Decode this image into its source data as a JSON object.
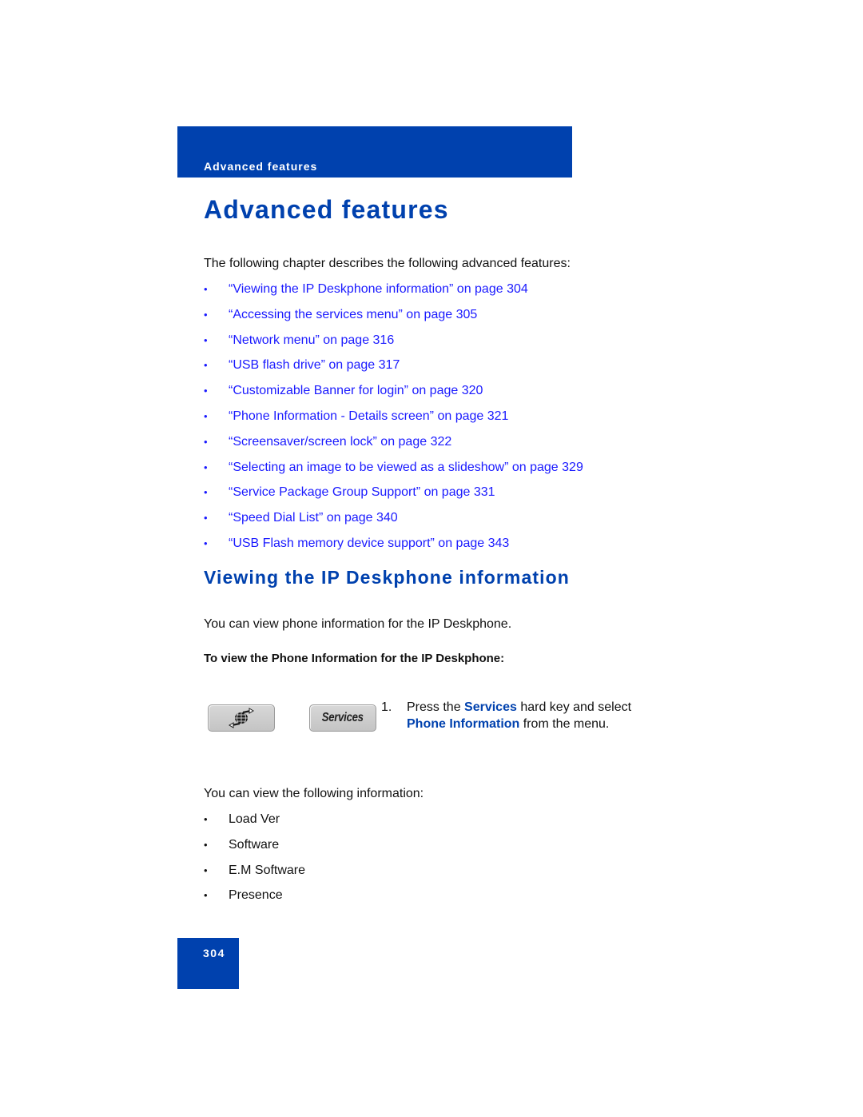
{
  "header": {
    "running_title": "Advanced features"
  },
  "page_title": "Advanced features",
  "intro": "The following chapter describes the following advanced features:",
  "toc": [
    {
      "label": "“Viewing the IP Deskphone information” on page 304"
    },
    {
      "label": "“Accessing the services menu” on page 305"
    },
    {
      "label": "“Network menu” on page 316"
    },
    {
      "label": "“USB flash drive” on page 317"
    },
    {
      "label": "“Customizable Banner for login” on page 320"
    },
    {
      "label": "“Phone Information - Details screen” on page 321"
    },
    {
      "label": "“Screensaver/screen lock” on page 322"
    },
    {
      "label": "“Selecting an image to be viewed as a slideshow” on page 329"
    },
    {
      "label": "“Service Package Group Support” on page 331"
    },
    {
      "label": "“Speed Dial List” on page 340"
    },
    {
      "label": "“USB Flash memory device support” on page 343"
    }
  ],
  "section": {
    "heading": "Viewing the IP Deskphone information",
    "intro": "You can view phone information for the IP Deskphone.",
    "procedure_heading": "To view the Phone Information for the IP Deskphone:",
    "keys": {
      "globe_icon": "globe-arrows-icon",
      "services_label": "Services"
    },
    "step": {
      "number": "1.",
      "part1": "Press the ",
      "term1": "Services",
      "part2": " hard key and select ",
      "term2": "Phone Information",
      "part3": " from the menu."
    },
    "info_intro": "You can view the following information:",
    "info_items": [
      {
        "label": "Load Ver"
      },
      {
        "label": "Software"
      },
      {
        "label": "E.M Software"
      },
      {
        "label": "Presence"
      }
    ]
  },
  "footer": {
    "page_number": "304"
  },
  "colors": {
    "brand_blue": "#0041ae",
    "link_blue": "#1a1aff"
  }
}
